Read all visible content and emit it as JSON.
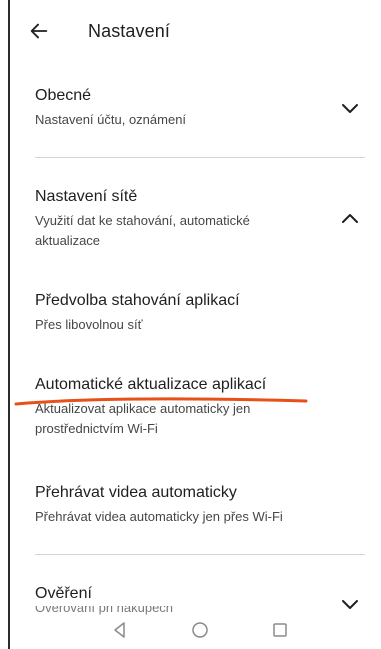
{
  "header": {
    "title": "Nastavení",
    "back_icon": "arrow-left-icon"
  },
  "sections": {
    "general": {
      "title": "Obecné",
      "subtitle": "Nastavení účtu, oznámení",
      "state": "collapsed"
    },
    "network": {
      "title": "Nastavení sítě",
      "subtitle": "Využití dat ke stahování, automatické aktualizace",
      "state": "expanded",
      "items": [
        {
          "title": "Předvolba stahování aplikací",
          "subtitle": "Přes libovolnou síť"
        },
        {
          "title": "Automatické aktualizace aplikací",
          "subtitle": "Aktualizovat aplikace automaticky jen prostřednictvím Wi-Fi"
        },
        {
          "title": "Přehrávat videa automaticky",
          "subtitle": "Přehrávat videa automaticky jen přes Wi-Fi"
        }
      ]
    },
    "verification": {
      "title": "Ověření",
      "subtitle_partial": "Ověřování při nákupech",
      "state": "collapsed"
    }
  },
  "annotation": {
    "underline_color": "#e8501a"
  },
  "nav": {
    "back": "nav-back-icon",
    "home": "nav-home-icon",
    "recents": "nav-recents-icon"
  }
}
